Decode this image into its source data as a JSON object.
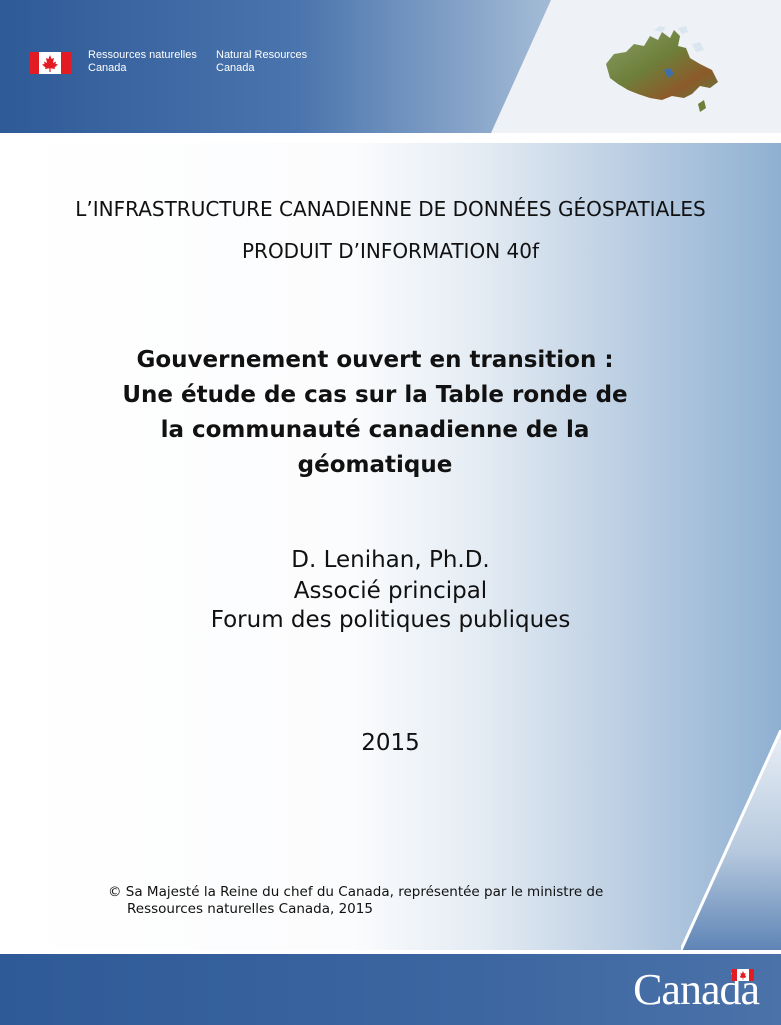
{
  "header": {
    "signature_fr_line1": "Ressources naturelles",
    "signature_fr_line2": "Canada",
    "signature_en_line1": "Natural Resources",
    "signature_en_line2": "Canada",
    "flag_icon": "canada-flag-icon",
    "map_icon": "canada-map-icon",
    "colors": {
      "band": "#2e5a97",
      "flag_red": "#e31b23"
    }
  },
  "document": {
    "supertitle_line1": "L’INFRASTRUCTURE CANADIENNE DE DONNÉES GÉOSPATIALES",
    "supertitle_line2": "PRODUIT D’INFORMATION 40f",
    "title_line1": "Gouvernement ouvert en transition :",
    "title_line2": "Une étude de cas sur la Table ronde de",
    "title_line3": "la communauté canadienne de la",
    "title_line4": "géomatique",
    "author_name": "D. Lenihan, Ph.D.",
    "author_role": "Associé principal",
    "author_org": "Forum des politiques publiques",
    "year": "2015",
    "copyright_line1": "© Sa Majesté la Reine du chef du Canada, représentée par le ministre de",
    "copyright_line2": "Ressources naturelles Canada, 2015"
  },
  "footer": {
    "wordmark": "Canada",
    "wordmark_flag_icon": "canada-flag-icon"
  }
}
